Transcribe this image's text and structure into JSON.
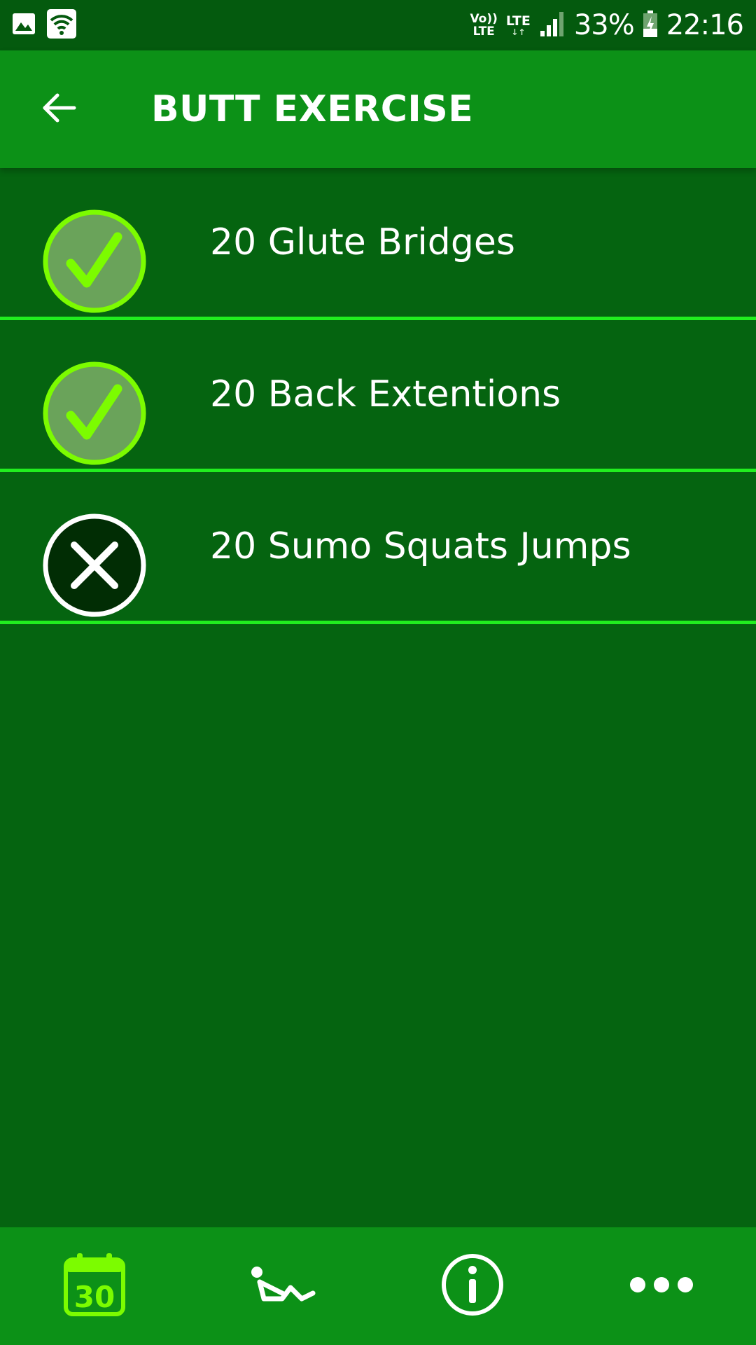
{
  "status_bar": {
    "volte_top": "Vo))",
    "volte_bottom": "LTE",
    "network": "LTE",
    "network_arrows": "↓↑",
    "battery_percent": "33%",
    "time": "22:16"
  },
  "app_bar": {
    "title": "BUTT EXERCISE"
  },
  "exercises": [
    {
      "label": "20 Glute Bridges",
      "status": "done"
    },
    {
      "label": "20 Back Extentions",
      "status": "done"
    },
    {
      "label": "20 Sumo Squats Jumps",
      "status": "skipped"
    }
  ],
  "bottom_nav": {
    "calendar_day": "30",
    "icons": [
      "calendar-30-icon",
      "exercise-icon",
      "info-icon",
      "more-icon"
    ]
  },
  "colors": {
    "status_bar": "#045a0e",
    "app_bar": "#0c9117",
    "background": "#056410",
    "divider": "#21ee1f",
    "accent": "#7cfc00"
  }
}
